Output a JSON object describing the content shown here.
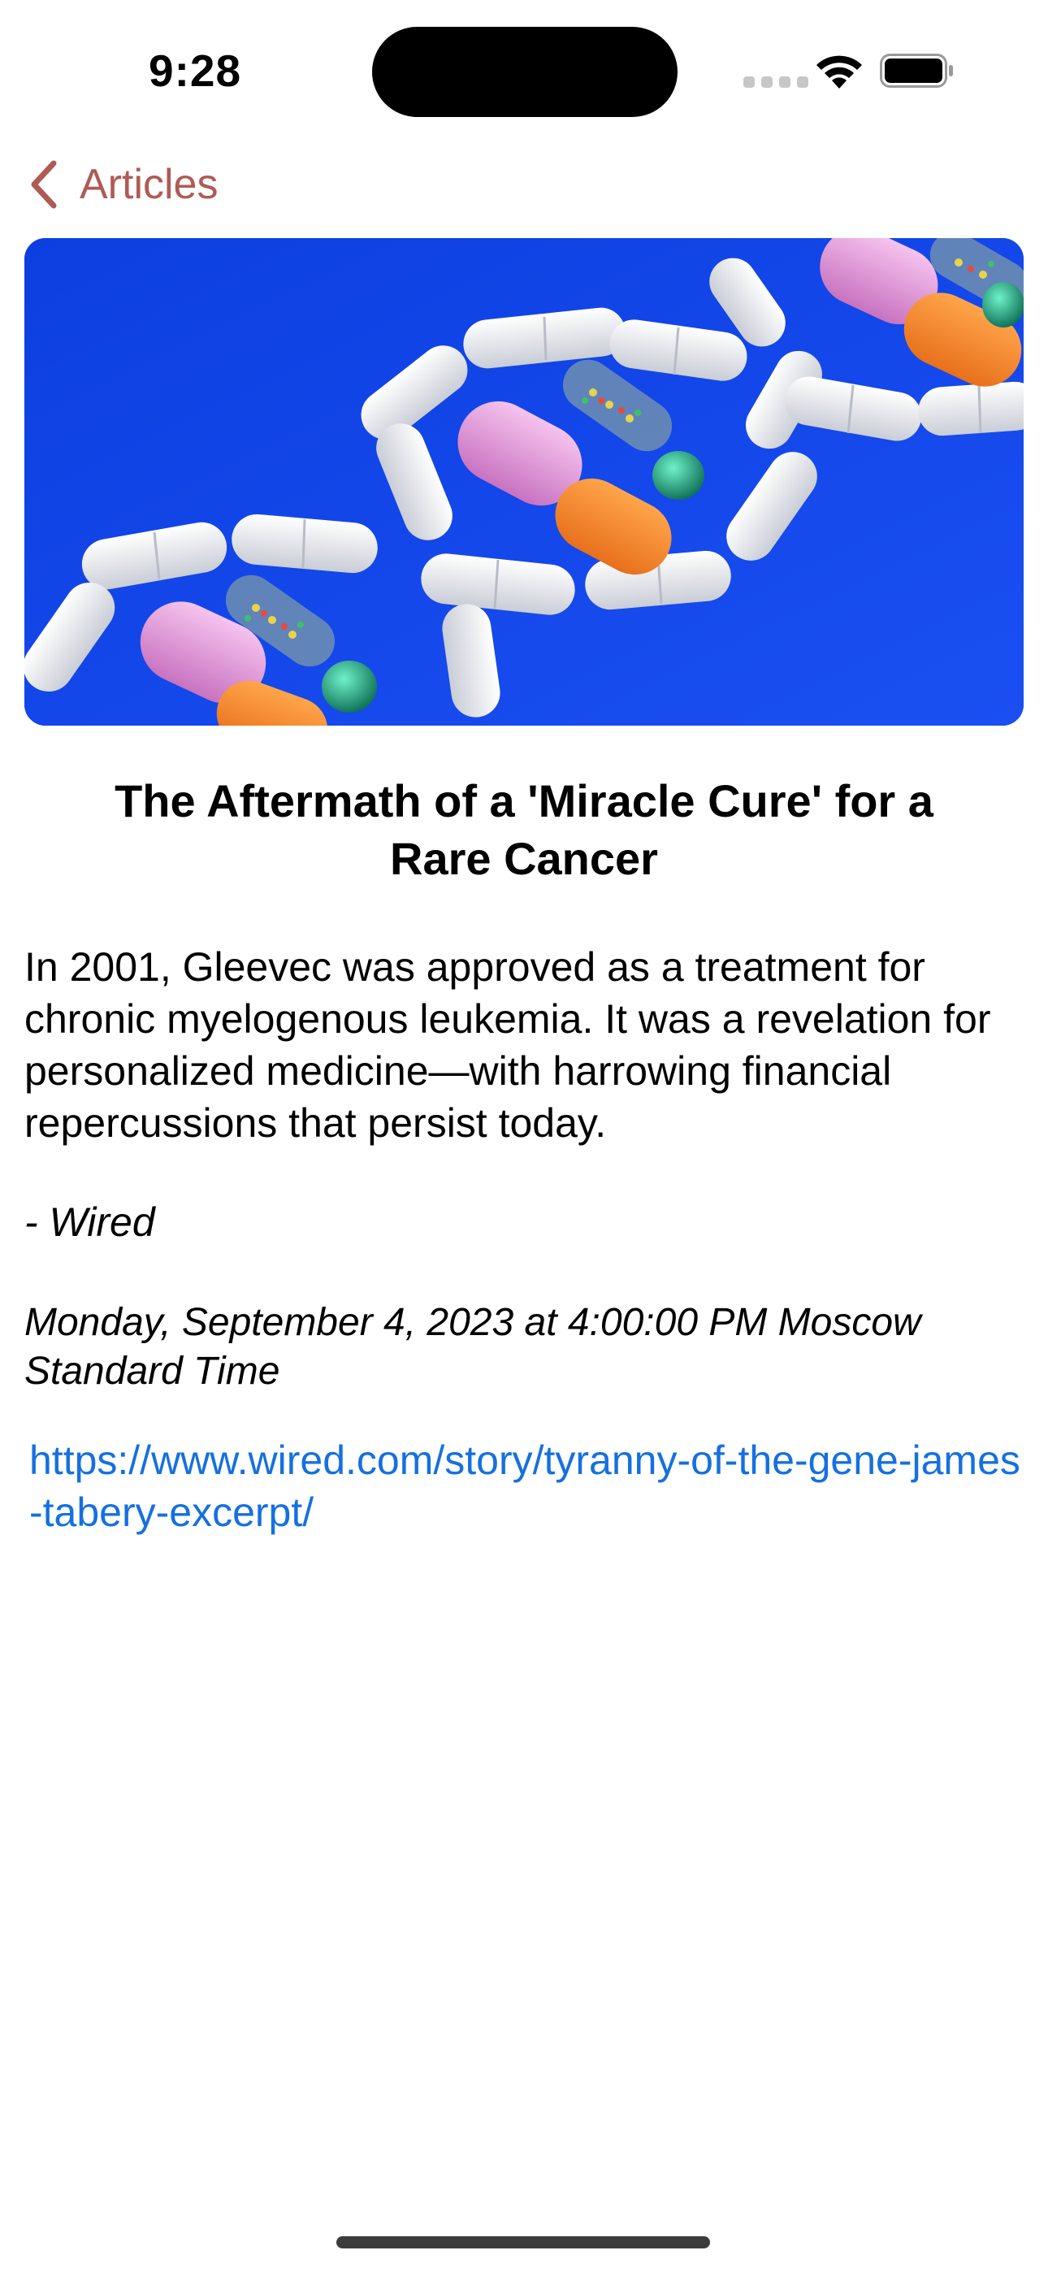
{
  "status_bar": {
    "time": "9:28"
  },
  "nav": {
    "back_label": "Articles",
    "accent_color": "#b05a55"
  },
  "article": {
    "image_description_icon": "photo-pills-dna",
    "title": "The Aftermath of a 'Miracle Cure' for a Rare Cancer",
    "summary": "In 2001, Gleevec was approved as a treatment for chronic myelogenous leukemia. It was a revelation for personalized medicine—with harrowing financial repercussions that persist today.",
    "source": "- Wired",
    "date": "Monday, September 4, 2023 at 4:00:00 PM Moscow Standard Time",
    "url": "https://www.wired.com/story/tyranny-of-the-gene-james-tabery-excerpt/",
    "link_color": "#1570e0"
  }
}
